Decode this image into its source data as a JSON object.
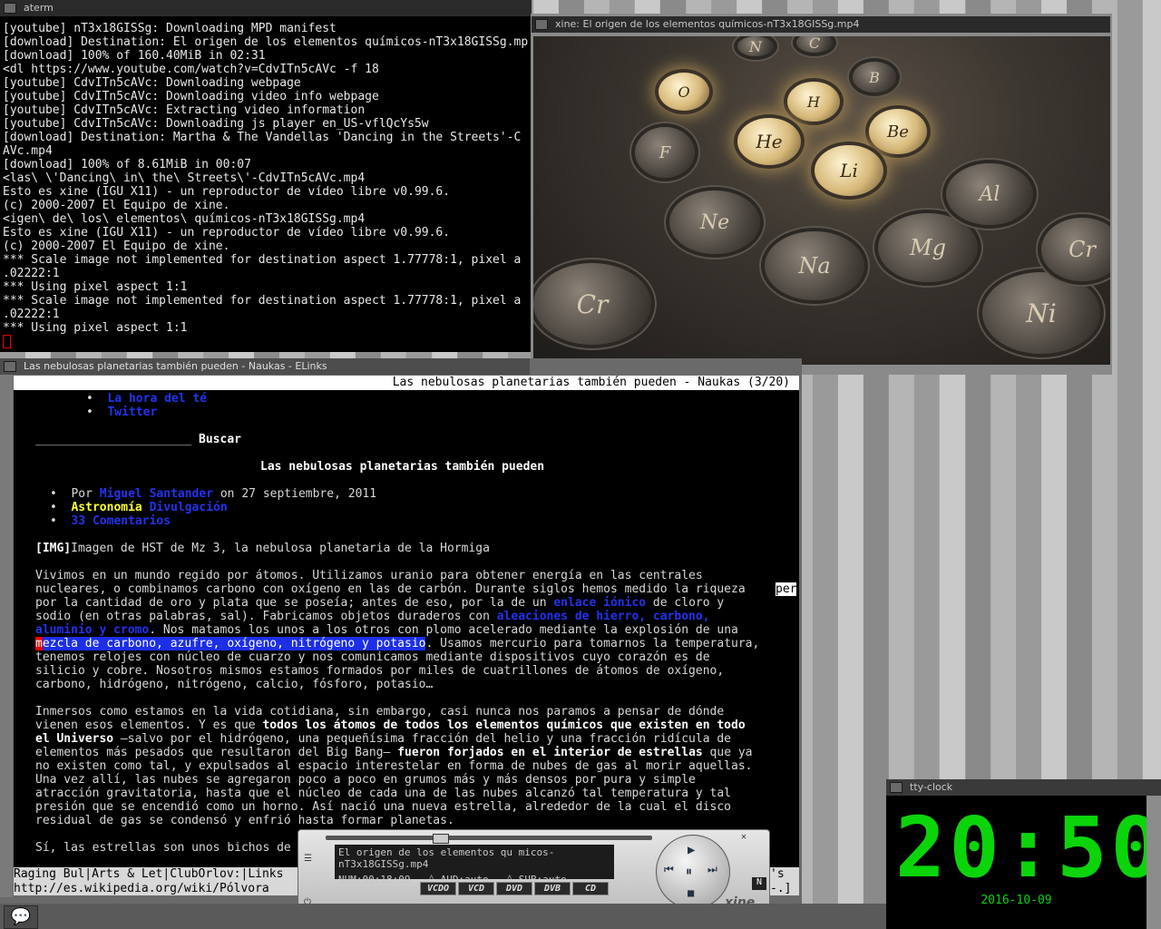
{
  "aterm": {
    "title": "aterm",
    "lines": [
      "[youtube] nT3x18GISSg: Downloading MPD manifest",
      "[download] Destination: El origen de los elementos químicos-nT3x18GISSg.mp",
      "[download] 100% of 160.40MiB in 02:31",
      "<dl https://www.youtube.com/watch?v=CdvITn5cAVc -f 18",
      "[youtube] CdvITn5cAVc: Downloading webpage",
      "[youtube] CdvITn5cAVc: Downloading video info webpage",
      "[youtube] CdvITn5cAVc: Extracting video information",
      "[youtube] CdvITn5cAVc: Downloading js player en_US-vflQcYs5w",
      "[download] Destination: Martha & The Vandellas 'Dancing in the Streets'-C",
      "AVc.mp4",
      "[download] 100% of 8.61MiB in 00:07",
      "<las\\ \\'Dancing\\ in\\ the\\ Streets\\'-CdvITn5cAVc.mp4",
      "Esto es xine (IGU X11) - un reproductor de vídeo libre v0.99.6.",
      "(c) 2000-2007 El Equipo de xine.",
      "<igen\\ de\\ los\\ elementos\\ químicos-nT3x18GISSg.mp4",
      "Esto es xine (IGU X11) - un reproductor de vídeo libre v0.99.6.",
      "(c) 2000-2007 El Equipo de xine.",
      "*** Scale image not implemented for destination aspect 1.77778:1, pixel a",
      ".02222:1",
      "*** Using pixel aspect 1:1",
      "*** Scale image not implemented for destination aspect 1.77778:1, pixel a",
      ".02222:1",
      "*** Using pixel aspect 1:1"
    ]
  },
  "xine": {
    "title": "xine: El origen de los elementos químicos-nT3x18GISSg.mp4",
    "elements": [
      "N",
      "C",
      "B",
      "O",
      "H",
      "Be",
      "He",
      "Li",
      "F",
      "Ne",
      "Na",
      "Mg",
      "Al",
      "Cr",
      "Ni",
      "Cr"
    ]
  },
  "elinks": {
    "window_title": "Las nebulosas planetarias también pueden - Naukas - ELinks",
    "top_title": "Las nebulosas planetarias también pueden - Naukas (3/20)",
    "menu_items": [
      "La hora del té",
      "Twitter"
    ],
    "search_line": "______________________",
    "search_label": "Buscar",
    "article_title": "Las nebulosas planetarias también pueden",
    "by": "Por",
    "author": "Miguel Santander",
    "date": "on 27 septiembre, 2011",
    "cat1": "Astronomía",
    "cat2": "Divulgación",
    "comments": "33 Comentarios",
    "img_tag": "[IMG]",
    "img_caption": "Imagen de HST de Mz 3, la nebulosa planetaria de la Hormiga",
    "p1_l1": "Vivimos en un mundo regido por átomos. Utilizamos uranio para obtener energía en las centrales",
    "p1_l2": "nucleares, o combinamos carbono con oxígeno en las de carbón. Durante siglos hemos medido la riqueza",
    "p1_l2_tail": "per",
    "p1_l3a": "por la cantidad de oro y plata que se poseía; antes de eso, por la de un ",
    "p1_l3_link": "enlace iónico",
    "p1_l3b": " de cloro y",
    "p1_l4a": "sodio (en otras palabras, sal). Fabricamos objetos duraderos con ",
    "p1_l4_link": "aleaciones de hierro, carbono,",
    "p1_l5_link": "aluminio y cromo",
    "p1_l5b": ". Nos matamos los unos a los otros con plomo acelerado mediante la explosión de una",
    "p1_l6_cur": "m",
    "p1_l6_sel": "ezcla de carbono, azufre, oxígeno, nitrógeno y potasio",
    "p1_l6b": ". Usamos mercurio para tomarnos la temperatura,",
    "p1_l7": "tenemos relojes con núcleo de cuarzo y nos comunicamos mediante dispositivos cuyo corazón es de",
    "p1_l8": "silicio y cobre. Nosotros mismos estamos formados por miles de cuatrillones de átomos de oxígeno,",
    "p1_l9": "carbono, hidrógeno, nitrógeno, calcio, fósforo, potasio…",
    "p2_l1": "Inmersos como estamos en la vida cotidiana, sin embargo, casi nunca nos paramos a pensar de dónde",
    "p2_l2a": "vienen esos elementos. Y es que ",
    "p2_l2_b": "todos los átomos de todos los elementos químicos que existen en todo",
    "p2_l3_b": "el Universo",
    "p2_l3b": " —salvo por el hidrógeno, una pequeñísima fracción del helio y una fracción ridícula de",
    "p2_l4a": "elementos más pesados que resultaron del Big Bang— ",
    "p2_l4_b": "fueron forjados en el interior de estrellas",
    "p2_l4b": " que ya",
    "p2_l5": "no existen como tal, y expulsados al espacio interestelar en forma de nubes de gas al morir aquellas.",
    "p2_l6": "Una vez allí, las nubes se agregaron poco a poco en grumos más y más densos por pura y simple",
    "p2_l7": "atracción gravitatoria, hasta que el núcleo de cada una de las nubes alcanzó tal temperatura y tal",
    "p2_l8": "presión que se encendió como un horno. Así nació una nueva estrella, alrededor de la cual el disco",
    "p2_l9": "residual de gas se condensó y enfrió hasta formar planetas.",
    "p3_l1": "Sí, las estrellas son unos bichos de",
    "tabs": [
      "Raging Bul",
      "Arts & Let",
      "ClubOrlov:",
      "Links"
    ],
    "tabs_tail": "'s",
    "status_url": "http://es.wikipedia.org/wiki/Pólvora",
    "status_tail": "-.]"
  },
  "xine_panel": {
    "title_text": "El origen de los elementos qu micos-nT3x18GISSg.mp4",
    "time_text": "NUM:00:18:09",
    "aud_text": "◊ AUD:auto",
    "sub_text": "◊ SUB:auto",
    "buttons": [
      "VCDO",
      "VCD",
      "DVD",
      "DVB",
      "CD"
    ],
    "n_label": "N",
    "logo": "xine"
  },
  "clock": {
    "title": "tty-clock",
    "time": "20:50",
    "date": "2016-10-09"
  }
}
